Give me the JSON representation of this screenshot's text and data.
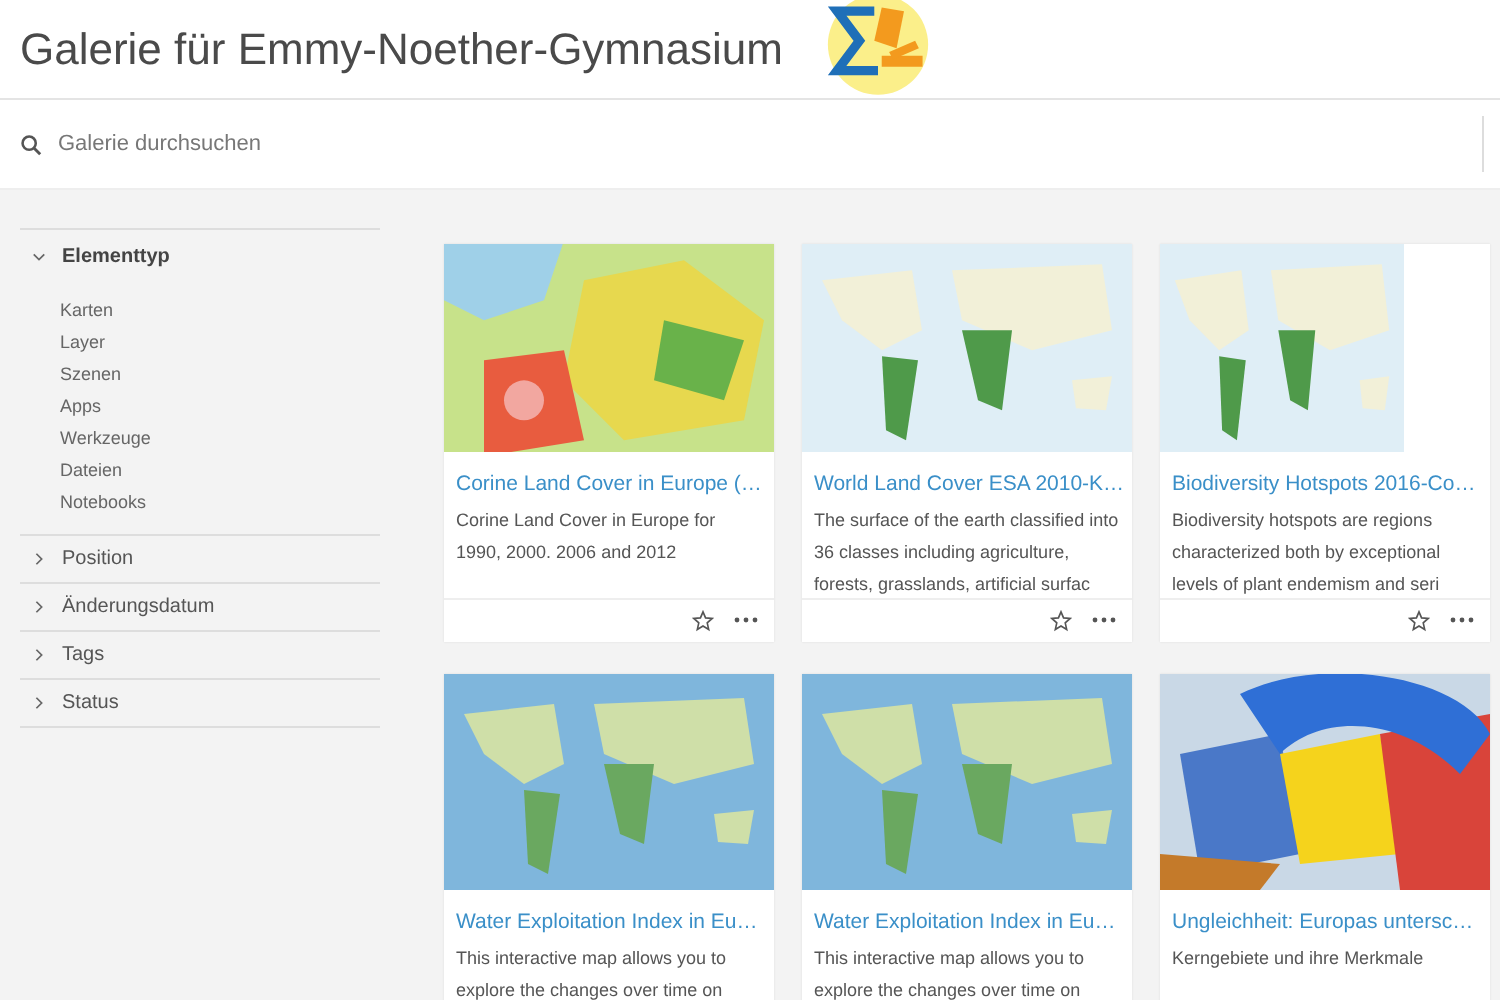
{
  "header": {
    "title": "Galerie für Emmy-Noether-Gymnasium"
  },
  "search": {
    "placeholder": "Galerie durchsuchen"
  },
  "filters": [
    {
      "label": "Elementtyp",
      "expanded": true,
      "items": [
        "Karten",
        "Layer",
        "Szenen",
        "Apps",
        "Werkzeuge",
        "Dateien",
        "Notebooks"
      ]
    },
    {
      "label": "Position",
      "expanded": false
    },
    {
      "label": "Änderungsdatum",
      "expanded": false
    },
    {
      "label": "Tags",
      "expanded": false
    },
    {
      "label": "Status",
      "expanded": false
    }
  ],
  "cards": [
    {
      "kind": "picture",
      "title": "Corine Land Cover in Europe (…",
      "description": "Corine Land Cover in Europe for 1990, 2000. 2006 and 2012",
      "footer": true
    },
    {
      "kind": "picture",
      "title": "World Land Cover ESA 2010-K…",
      "description": "The surface of the earth classified into 36 classes including agriculture, forests, grasslands, artificial surfac",
      "footer": true
    },
    {
      "kind": "picture",
      "title": "Biodiversity Hotspots 2016-Co…",
      "description": "Biodiversity hotspots are regions characterized both by exceptional levels of plant endemism and seri",
      "footer": true
    },
    {
      "kind": "picture",
      "title": "Water Exploitation Index in Eu…",
      "description": "This interactive map allows you to explore the changes over time on",
      "footer": false
    },
    {
      "kind": "picture",
      "title": "Water Exploitation Index in Eu…",
      "description": "This interactive map allows you to explore the changes over time on",
      "footer": false
    },
    {
      "kind": "picture",
      "title": "Ungleichheit: Europas untersc…",
      "description": "Kerngebiete und ihre Merkmale",
      "footer": false
    }
  ]
}
